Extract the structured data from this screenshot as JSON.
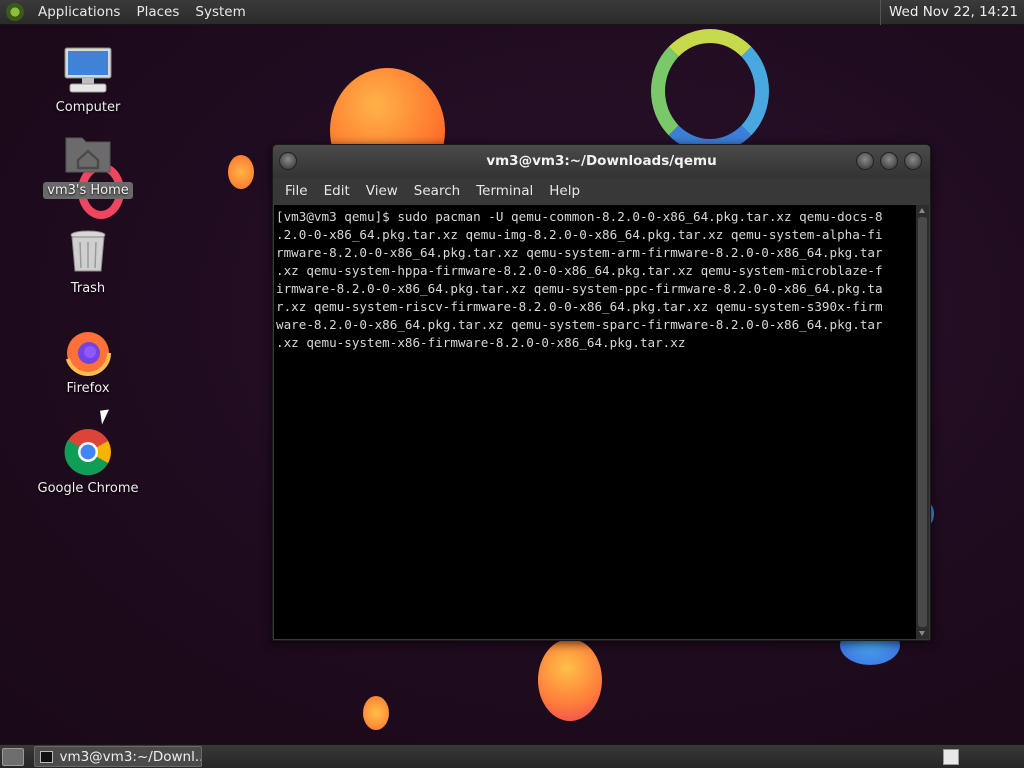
{
  "top_panel": {
    "menus": [
      "Applications",
      "Places",
      "System"
    ],
    "clock": "Wed Nov 22, 14:21"
  },
  "desktop_icons": [
    {
      "label": "Computer",
      "icon": "computer-icon"
    },
    {
      "label": "vm3's Home",
      "icon": "home-folder-icon",
      "selected": true
    },
    {
      "label": "Trash",
      "icon": "trash-icon"
    },
    {
      "label": "Firefox",
      "icon": "firefox-icon"
    },
    {
      "label": "Google Chrome",
      "icon": "chrome-icon"
    }
  ],
  "terminal": {
    "title": "vm3@vm3:~/Downloads/qemu",
    "menu": [
      "File",
      "Edit",
      "View",
      "Search",
      "Terminal",
      "Help"
    ],
    "lines": [
      "[vm3@vm3 qemu]$ sudo pacman -U qemu-common-8.2.0-0-x86_64.pkg.tar.xz qemu-docs-8",
      ".2.0-0-x86_64.pkg.tar.xz qemu-img-8.2.0-0-x86_64.pkg.tar.xz qemu-system-alpha-fi",
      "rmware-8.2.0-0-x86_64.pkg.tar.xz qemu-system-arm-firmware-8.2.0-0-x86_64.pkg.tar",
      ".xz qemu-system-hppa-firmware-8.2.0-0-x86_64.pkg.tar.xz qemu-system-microblaze-f",
      "irmware-8.2.0-0-x86_64.pkg.tar.xz qemu-system-ppc-firmware-8.2.0-0-x86_64.pkg.ta",
      "r.xz qemu-system-riscv-firmware-8.2.0-0-x86_64.pkg.tar.xz qemu-system-s390x-firm",
      "ware-8.2.0-0-x86_64.pkg.tar.xz qemu-system-sparc-firmware-8.2.0-0-x86_64.pkg.tar",
      ".xz qemu-system-x86-firmware-8.2.0-0-x86_64.pkg.tar.xz"
    ]
  },
  "taskbar": {
    "task_label": "vm3@vm3:~/Downl..."
  },
  "colors": {
    "panel": "#2b2b2b",
    "terminal_bg": "#000000",
    "terminal_fg": "#d8d8d8",
    "wallpaper": "#1f0d1f"
  }
}
